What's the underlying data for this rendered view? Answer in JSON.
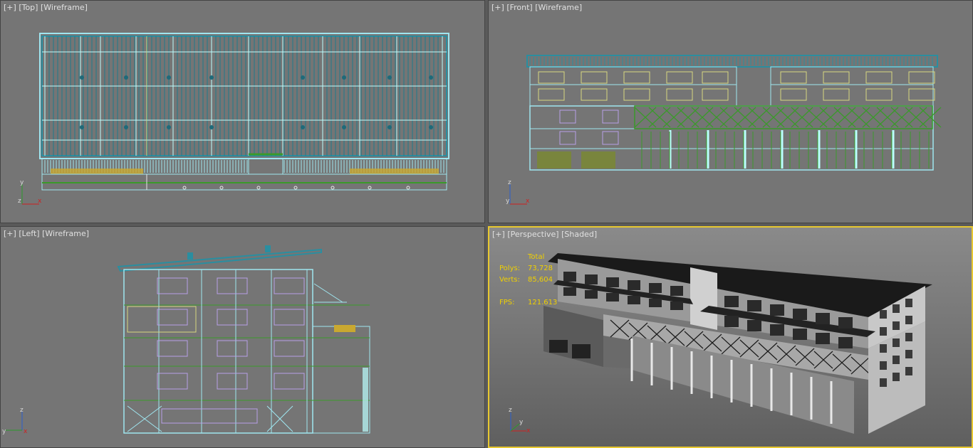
{
  "viewports": {
    "top": {
      "plus": "[+]",
      "view": "[Top]",
      "mode": "[Wireframe]"
    },
    "front": {
      "plus": "[+]",
      "view": "[Front]",
      "mode": "[Wireframe]"
    },
    "left": {
      "plus": "[+]",
      "view": "[Left]",
      "mode": "[Wireframe]"
    },
    "persp": {
      "plus": "[+]",
      "view": "[Perspective]",
      "mode": "[Shaded]"
    }
  },
  "stats": {
    "header": "Total",
    "polys_label": "Polys:",
    "polys": "73,728",
    "verts_label": "Verts:",
    "verts": "85,604",
    "fps_label": "FPS:",
    "fps": "121.613"
  },
  "axes": {
    "top": [
      "y",
      "z",
      "x"
    ],
    "front": [
      "z",
      "y",
      "x"
    ],
    "left": [
      "z",
      "x",
      "y"
    ],
    "persp": [
      "z",
      "y",
      "x"
    ]
  },
  "colors": {
    "accent_active": "#e8c830",
    "wire_cyan": "#9fe6f0",
    "wire_teal": "#2a8ea0",
    "wire_green": "#3a9a2a",
    "wire_purple": "#b8a0e8",
    "wire_yellow": "#d8d880",
    "stats_text": "#f0d000"
  }
}
